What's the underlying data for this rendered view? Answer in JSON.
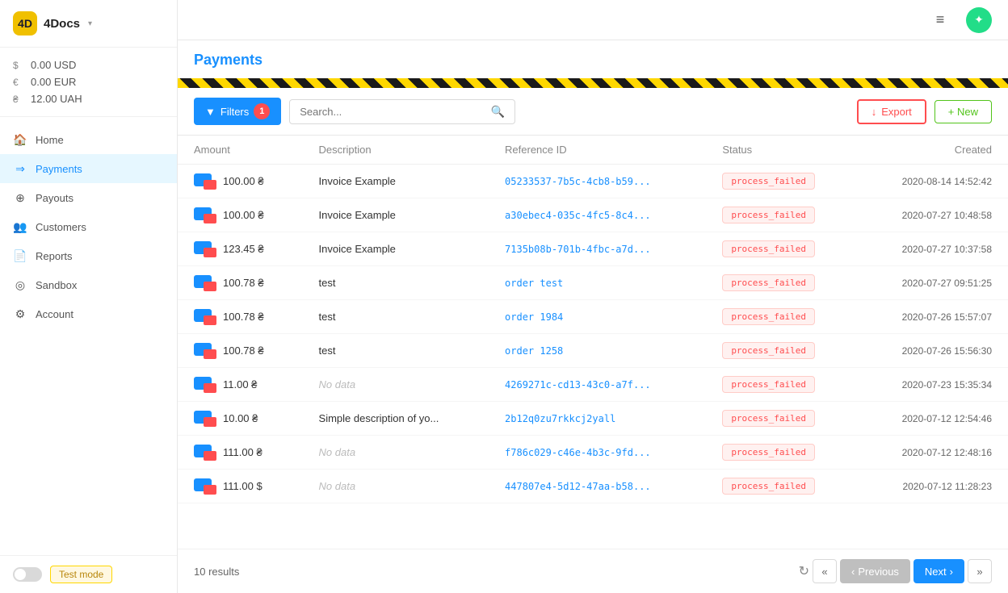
{
  "app": {
    "name": "4Docs",
    "logo_text": "4D"
  },
  "balances": [
    {
      "currency": "$",
      "amount": "0.00 USD"
    },
    {
      "currency": "€",
      "amount": "0.00 EUR"
    },
    {
      "currency": "₴",
      "amount": "12.00 UAH"
    }
  ],
  "nav": {
    "items": [
      {
        "id": "home",
        "label": "Home",
        "icon": "🏠",
        "active": false
      },
      {
        "id": "payments",
        "label": "Payments",
        "icon": "→",
        "active": true
      },
      {
        "id": "payouts",
        "label": "Payouts",
        "icon": "⊕",
        "active": false
      },
      {
        "id": "customers",
        "label": "Customers",
        "icon": "👥",
        "active": false
      },
      {
        "id": "reports",
        "label": "Reports",
        "icon": "📄",
        "active": false
      },
      {
        "id": "sandbox",
        "label": "Sandbox",
        "icon": "◎",
        "active": false
      },
      {
        "id": "account",
        "label": "Account",
        "icon": "⚙",
        "active": false
      }
    ],
    "test_mode_label": "Test mode"
  },
  "header": {
    "page_title": "Payments"
  },
  "toolbar": {
    "filter_label": "Filters",
    "filter_count": "1",
    "search_placeholder": "Search...",
    "export_label": "Export",
    "new_label": "+ New"
  },
  "table": {
    "columns": [
      "Amount",
      "Description",
      "Reference ID",
      "Status",
      "Created"
    ],
    "rows": [
      {
        "amount": "100.00 ₴",
        "description": "Invoice Example",
        "ref_id": "05233537-7b5c-4cb8-b59...",
        "status": "process_failed",
        "created": "2020-08-14 14:52:42"
      },
      {
        "amount": "100.00 ₴",
        "description": "Invoice Example",
        "ref_id": "a30ebec4-035c-4fc5-8c4...",
        "status": "process_failed",
        "created": "2020-07-27 10:48:58"
      },
      {
        "amount": "123.45 ₴",
        "description": "Invoice Example",
        "ref_id": "7135b08b-701b-4fbc-a7d...",
        "status": "process_failed",
        "created": "2020-07-27 10:37:58"
      },
      {
        "amount": "100.78 ₴",
        "description": "test",
        "ref_id": "order test",
        "status": "process_failed",
        "created": "2020-07-27 09:51:25",
        "ref_is_text": true
      },
      {
        "amount": "100.78 ₴",
        "description": "test",
        "ref_id": "order 1984",
        "status": "process_failed",
        "created": "2020-07-26 15:57:07",
        "ref_is_text": true
      },
      {
        "amount": "100.78 ₴",
        "description": "test",
        "ref_id": "order 1258",
        "status": "process_failed",
        "created": "2020-07-26 15:56:30",
        "ref_is_text": true
      },
      {
        "amount": "11.00 ₴",
        "description": "No data",
        "ref_id": "4269271c-cd13-43c0-a7f...",
        "status": "process_failed",
        "created": "2020-07-23 15:35:34",
        "no_data": true
      },
      {
        "amount": "10.00 ₴",
        "description": "Simple description of yo...",
        "ref_id": "2b12q0zu7rkkcj2yall",
        "status": "process_failed",
        "created": "2020-07-12 12:54:46",
        "ref_is_text": true
      },
      {
        "amount": "111.00 ₴",
        "description": "No data",
        "ref_id": "f786c029-c46e-4b3c-9fd...",
        "status": "process_failed",
        "created": "2020-07-12 12:48:16",
        "no_data": true
      },
      {
        "amount": "111.00 $",
        "description": "No data",
        "ref_id": "447807e4-5d12-47aa-b58...",
        "status": "process_failed",
        "created": "2020-07-12 11:28:23",
        "no_data": true
      }
    ]
  },
  "footer": {
    "results_text": "10 results",
    "prev_label": "Previous",
    "next_label": "Next"
  }
}
